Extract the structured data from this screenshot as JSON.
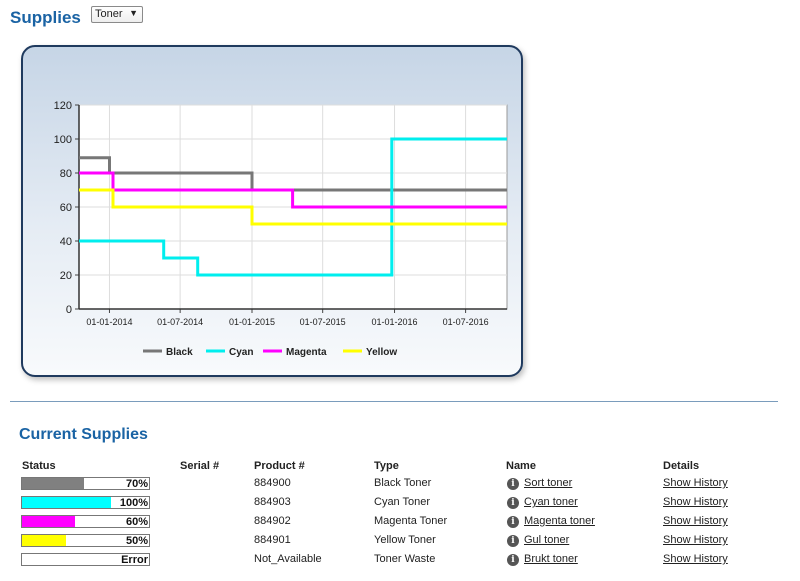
{
  "header": {
    "title": "Supplies",
    "select_value": "Toner"
  },
  "chart_data": {
    "type": "line",
    "x_ticks": [
      "01-01-2014",
      "01-07-2014",
      "01-01-2015",
      "01-07-2015",
      "01-01-2016",
      "01-07-2016"
    ],
    "y_ticks": [
      "0",
      "20",
      "40",
      "60",
      "80",
      "100",
      "120"
    ],
    "ylim": [
      0,
      120
    ],
    "xlim": [
      "2013-10-15",
      "2016-10-15"
    ],
    "grid": true,
    "legend_position": "bottom",
    "series": [
      {
        "name": "Black",
        "color": "#777777",
        "points": [
          [
            "2013-10-15",
            89
          ],
          [
            "2014-01-01",
            89
          ],
          [
            "2014-01-01",
            80
          ],
          [
            "2015-01-01",
            80
          ],
          [
            "2015-01-01",
            70
          ],
          [
            "2016-10-15",
            70
          ]
        ]
      },
      {
        "name": "Cyan",
        "color": "#00eeee",
        "points": [
          [
            "2013-10-15",
            40
          ],
          [
            "2014-05-20",
            40
          ],
          [
            "2014-05-20",
            30
          ],
          [
            "2014-08-15",
            30
          ],
          [
            "2014-08-15",
            20
          ],
          [
            "2015-12-25",
            20
          ],
          [
            "2015-12-25",
            100
          ],
          [
            "2016-10-15",
            100
          ]
        ]
      },
      {
        "name": "Magenta",
        "color": "#ff00ff",
        "points": [
          [
            "2013-10-15",
            80
          ],
          [
            "2014-01-10",
            80
          ],
          [
            "2014-01-10",
            70
          ],
          [
            "2015-04-15",
            70
          ],
          [
            "2015-04-15",
            60
          ],
          [
            "2016-10-15",
            60
          ]
        ]
      },
      {
        "name": "Yellow",
        "color": "#ffff00",
        "points": [
          [
            "2013-10-15",
            70
          ],
          [
            "2014-01-10",
            70
          ],
          [
            "2014-01-10",
            60
          ],
          [
            "2015-01-01",
            60
          ],
          [
            "2015-01-01",
            50
          ],
          [
            "2016-10-15",
            50
          ]
        ]
      }
    ]
  },
  "current": {
    "title": "Current Supplies",
    "headers": {
      "status": "Status",
      "serial": "Serial #",
      "product": "Product #",
      "type": "Type",
      "name": "Name",
      "details": "Details"
    },
    "rows": [
      {
        "level": 0.7,
        "status_text": "70%",
        "color": "#808080",
        "serial": "",
        "product": "884900",
        "type": "Black Toner",
        "name": "Sort toner",
        "details": "Show History"
      },
      {
        "level": 1.0,
        "status_text": "100%",
        "color": "#00ffff",
        "serial": "",
        "product": "884903",
        "type": "Cyan Toner",
        "name": "Cyan toner",
        "details": "Show History"
      },
      {
        "level": 0.6,
        "status_text": "60%",
        "color": "#ff00ff",
        "serial": "",
        "product": "884902",
        "type": "Magenta Toner",
        "name": "Magenta toner",
        "details": "Show History"
      },
      {
        "level": 0.5,
        "status_text": "50%",
        "color": "#ffff00",
        "serial": "",
        "product": "884901",
        "type": "Yellow Toner",
        "name": "Gul toner",
        "details": "Show History"
      },
      {
        "level": 0.0,
        "status_text": "Error",
        "color": "#ffffff",
        "serial": "",
        "product": "Not_Available",
        "type": "Toner Waste",
        "name": "Brukt toner",
        "details": "Show History"
      }
    ]
  },
  "icons": {
    "info": "info-icon",
    "dropdown": "chevron-down-icon"
  }
}
